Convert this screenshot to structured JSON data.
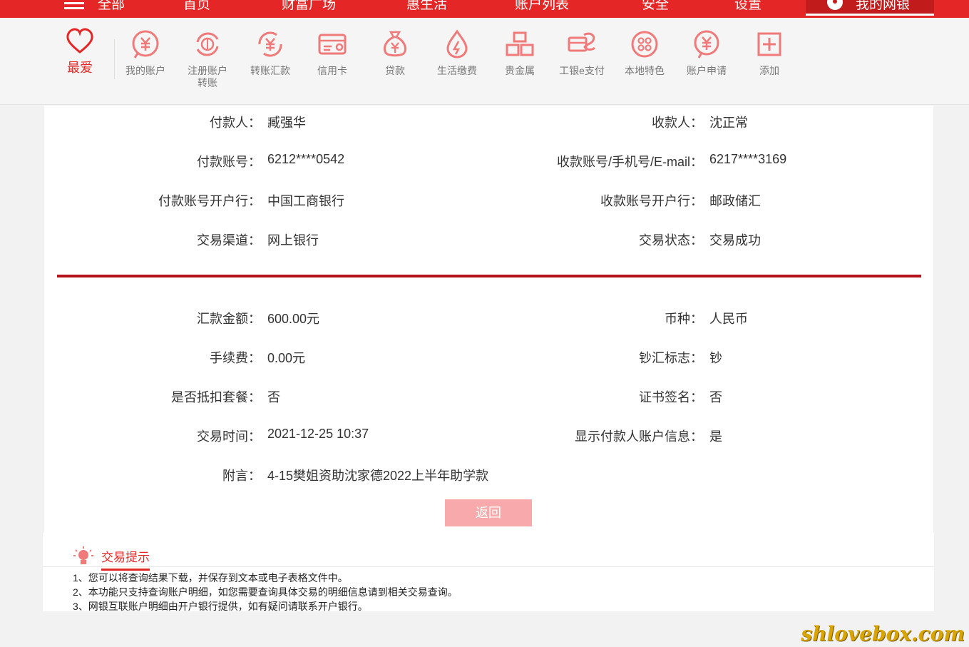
{
  "topnav": {
    "items": [
      "全部",
      "首页",
      "财富广场",
      "惠生活",
      "账户列表",
      "安全",
      "设置"
    ],
    "mybank": "我的网银"
  },
  "quickbar": {
    "favorite": "最爱",
    "items": [
      {
        "label": "我的账户",
        "icon": "yuan-coin-icon"
      },
      {
        "label": "注册账户转账",
        "icon": "refresh-coin-icon"
      },
      {
        "label": "转账汇款",
        "icon": "transfer-yuan-icon"
      },
      {
        "label": "信用卡",
        "icon": "credit-card-icon"
      },
      {
        "label": "贷款",
        "icon": "money-bag-icon"
      },
      {
        "label": "生活缴费",
        "icon": "water-drop-icon"
      },
      {
        "label": "贵金属",
        "icon": "gold-bars-icon"
      },
      {
        "label": "工银e支付",
        "icon": "e-pay-icon"
      },
      {
        "label": "本地特色",
        "icon": "local-dots-icon"
      },
      {
        "label": "账户申请",
        "icon": "apply-account-icon"
      },
      {
        "label": "添加",
        "icon": "add-icon"
      }
    ]
  },
  "details": {
    "payer_label": "付款人：",
    "payer": "臧强华",
    "payee_label": "收款人：",
    "payee": "沈正常",
    "payer_acct_label": "付款账号：",
    "payer_acct": "6212****0542",
    "payee_acct_label": "收款账号/手机号/E-mail：",
    "payee_acct": "6217****3169",
    "payer_bank_label": "付款账号开户行：",
    "payer_bank": "中国工商银行",
    "payee_bank_label": "收款账号开户行：",
    "payee_bank": "邮政储汇",
    "channel_label": "交易渠道：",
    "channel": "网上银行",
    "status_label": "交易状态：",
    "status": "交易成功",
    "amount_label": "汇款金额：",
    "amount": "600.00元",
    "currency_label": "币种：",
    "currency": "人民币",
    "fee_label": "手续费：",
    "fee": "0.00元",
    "cash_flag_label": "钞汇标志：",
    "cash_flag": "钞",
    "package_label": "是否抵扣套餐：",
    "package": "否",
    "cert_label": "证书签名：",
    "cert": "否",
    "time_label": "交易时间：",
    "time": "2021-12-25 10:37",
    "show_payer_label": "显示付款人账户信息：",
    "show_payer": "是",
    "memo_label": "附言：",
    "memo": "4-15樊姐资助沈家德2022上半年助学款"
  },
  "back_button": "返回",
  "tips": {
    "title": "交易提示",
    "items": [
      "1、您可以将查询结果下载，并保存到文本或电子表格文件中。",
      "2、本功能只支持查询账户明细，如您需要查询具体交易的明细信息请到相关交易查询。",
      "3、网银互联账户明细由开户银行提供，如有疑问请联系开户银行。"
    ]
  },
  "watermark": "shlovebox.com",
  "colors": {
    "brand_red": "#e42726",
    "divider": "#b5121b",
    "button_disabled": "#f8a9ab"
  }
}
